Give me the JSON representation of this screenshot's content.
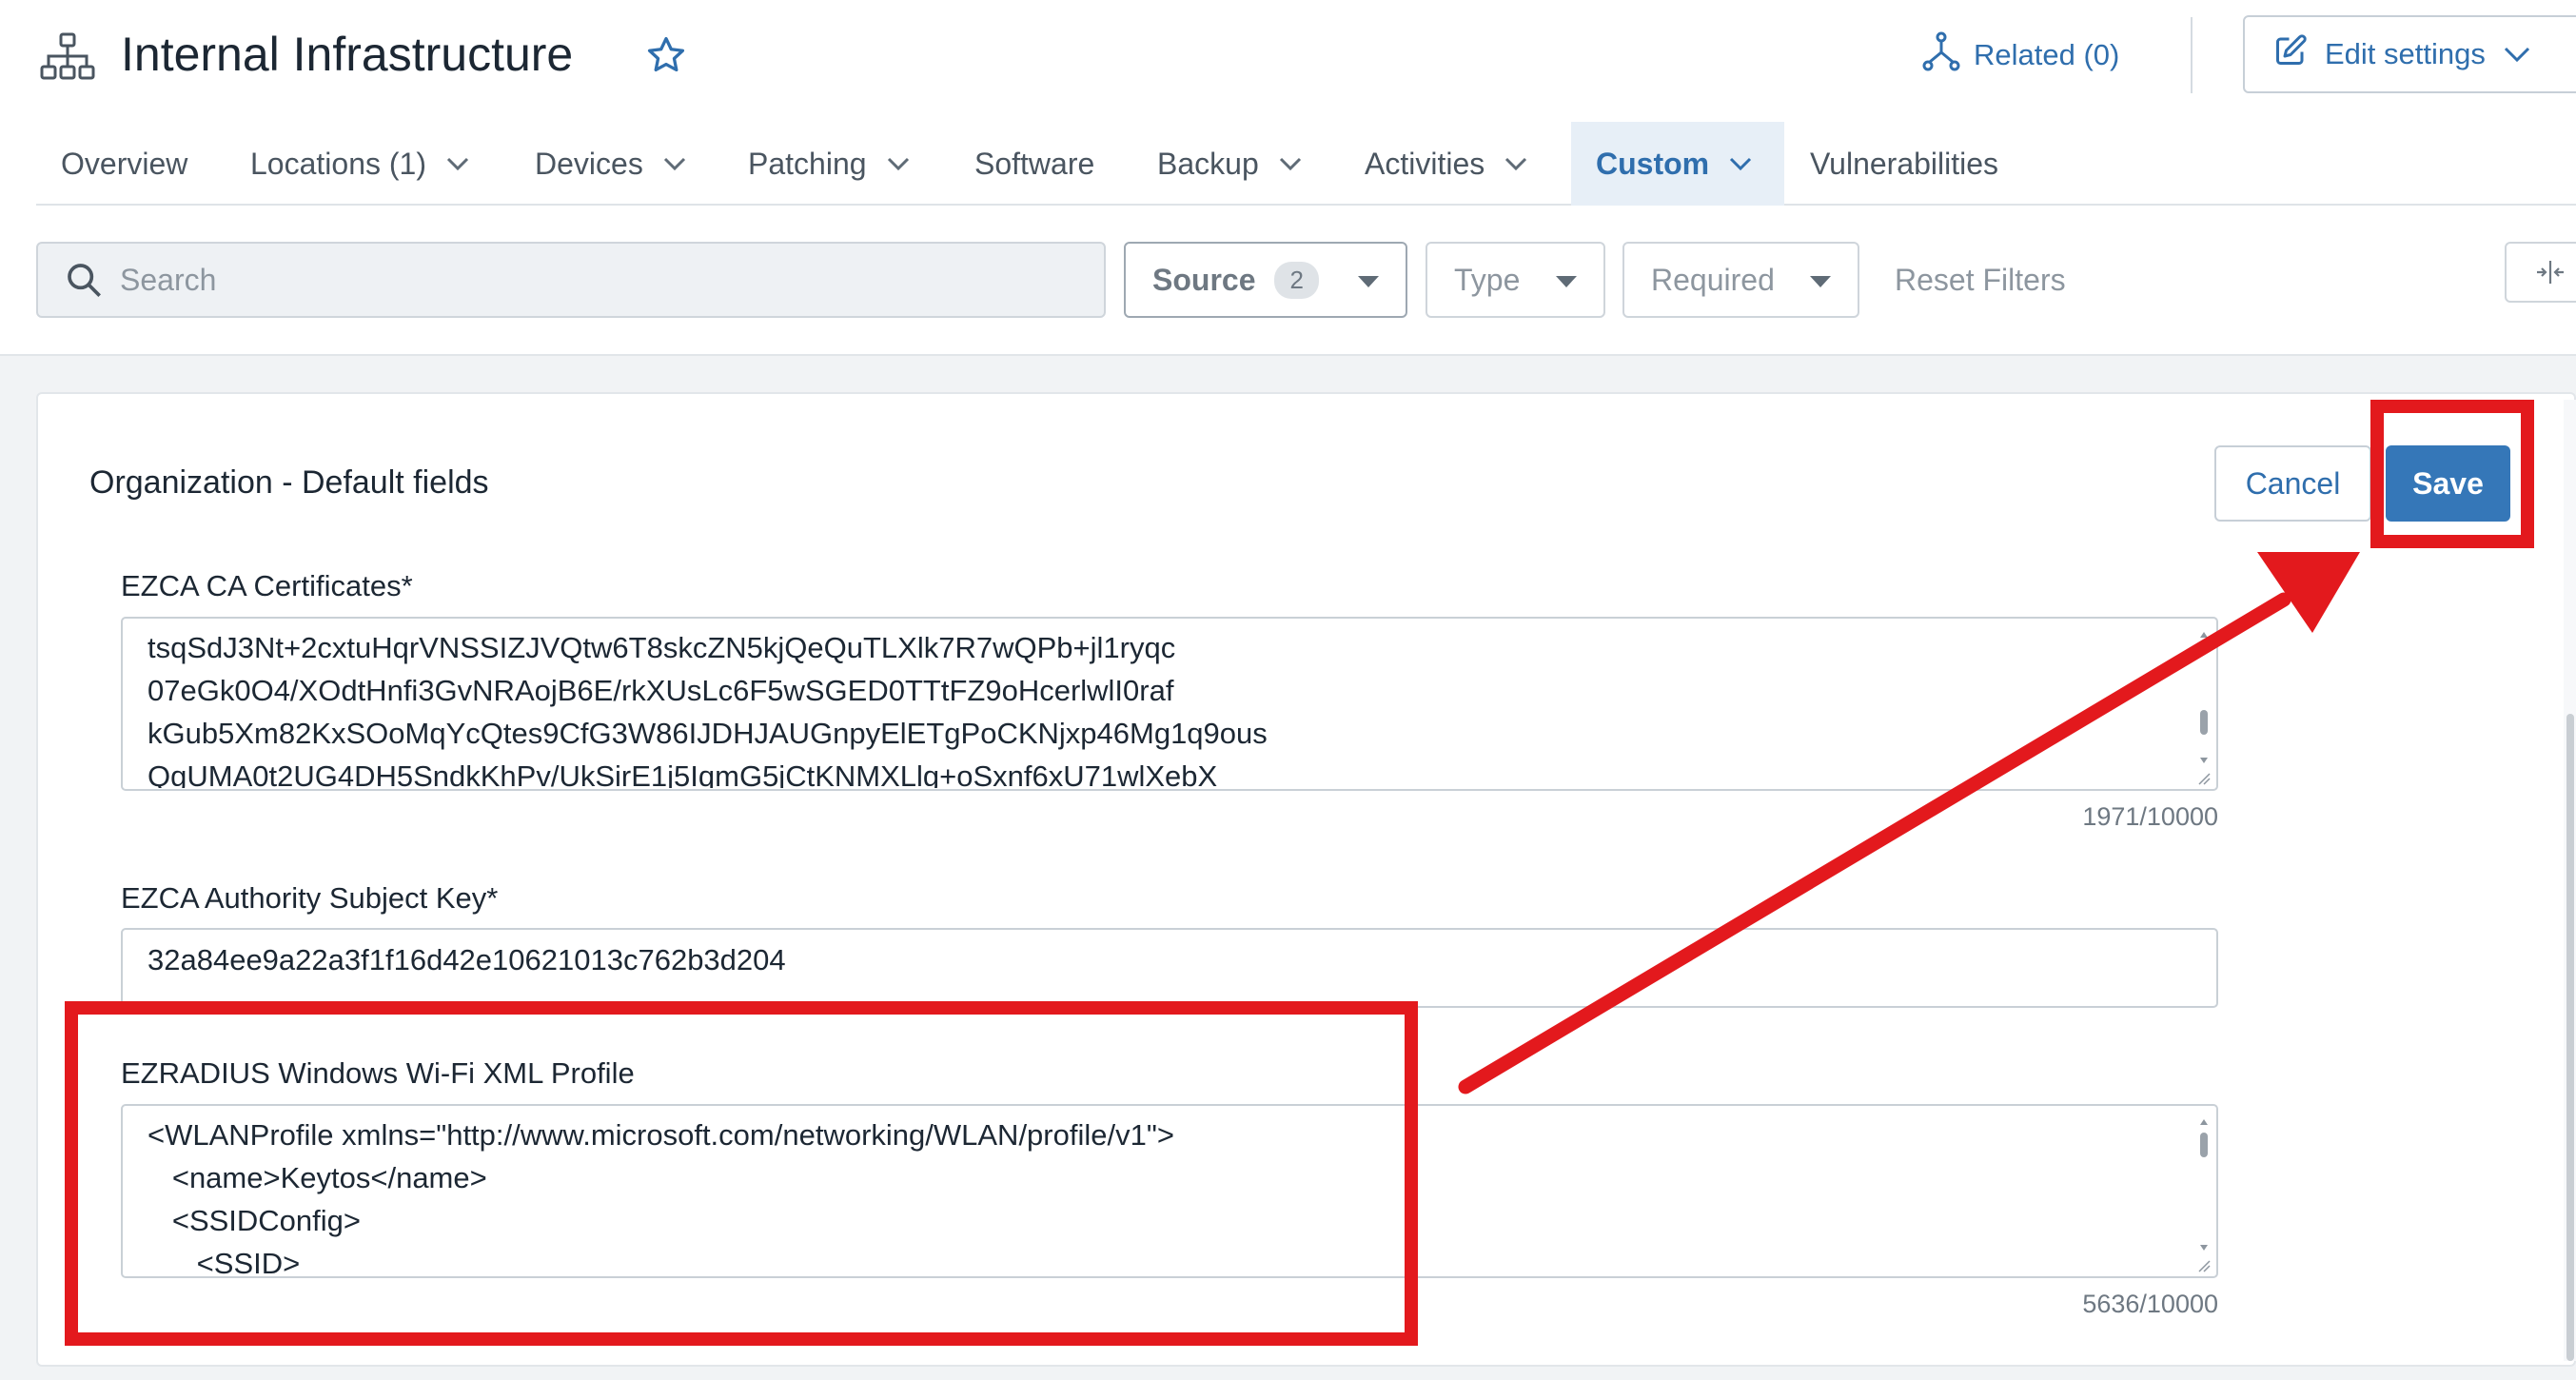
{
  "header": {
    "title": "Internal Infrastructure",
    "related_label": "Related (0)",
    "edit_settings_label": "Edit settings"
  },
  "tabs": [
    {
      "label": "Overview",
      "has_menu": false,
      "active": false
    },
    {
      "label": "Locations (1)",
      "has_menu": true,
      "active": false
    },
    {
      "label": "Devices",
      "has_menu": true,
      "active": false
    },
    {
      "label": "Patching",
      "has_menu": true,
      "active": false
    },
    {
      "label": "Software",
      "has_menu": false,
      "active": false
    },
    {
      "label": "Backup",
      "has_menu": true,
      "active": false
    },
    {
      "label": "Activities",
      "has_menu": true,
      "active": false
    },
    {
      "label": "Custom",
      "has_menu": true,
      "active": true
    },
    {
      "label": "Vulnerabilities",
      "has_menu": false,
      "active": false
    }
  ],
  "filters": {
    "search_placeholder": "Search",
    "source_label": "Source",
    "source_count": "2",
    "type_label": "Type",
    "required_label": "Required",
    "reset_label": "Reset Filters"
  },
  "section": {
    "title": "Organization - Default fields",
    "cancel_label": "Cancel",
    "save_label": "Save"
  },
  "fields": {
    "ca_certs": {
      "label": "EZCA CA Certificates*",
      "value": "tsqSdJ3Nt+2cxtuHqrVNSSIZJVQtw6T8skcZN5kjQeQuTLXlk7R7wQPb+jl1ryqc\n07eGk0O4/XOdtHnfi3GvNRAojB6E/rkXUsLc6F5wSGED0TTtFZ9oHcerlwlI0raf\nkGub5Xm82KxSOoMqYcQtes9CfG3W86IJDHJAUGnpyElETgPoCKNjxp46Mg1q9ous\nQgUMA0t2UG4DH5SndkKhPv/UkSirE1j5IqmG5jCtKNMXLlg+oSxnf6xU71wlXebX",
      "counter": "1971/10000"
    },
    "authority_key": {
      "label": "EZCA Authority Subject Key*",
      "value": "32a84ee9a22a3f1f16d42e10621013c762b3d204"
    },
    "wifi_profile": {
      "label": "EZRADIUS Windows Wi-Fi XML Profile",
      "value": "<WLANProfile xmlns=\"http://www.microsoft.com/networking/WLAN/profile/v1\">\n   <name>Keytos</name>\n   <SSIDConfig>\n      <SSID>",
      "counter": "5636/10000"
    }
  },
  "colors": {
    "accent": "#2f6ead",
    "save_button": "#3577b8",
    "annotation_red": "#e3191d"
  },
  "icons": {
    "org": "org-chart-icon",
    "favorite": "star-outline-icon",
    "related": "related-graph-icon",
    "edit": "edit-pencil-icon",
    "search": "search-icon",
    "split": "split-view-icon"
  }
}
